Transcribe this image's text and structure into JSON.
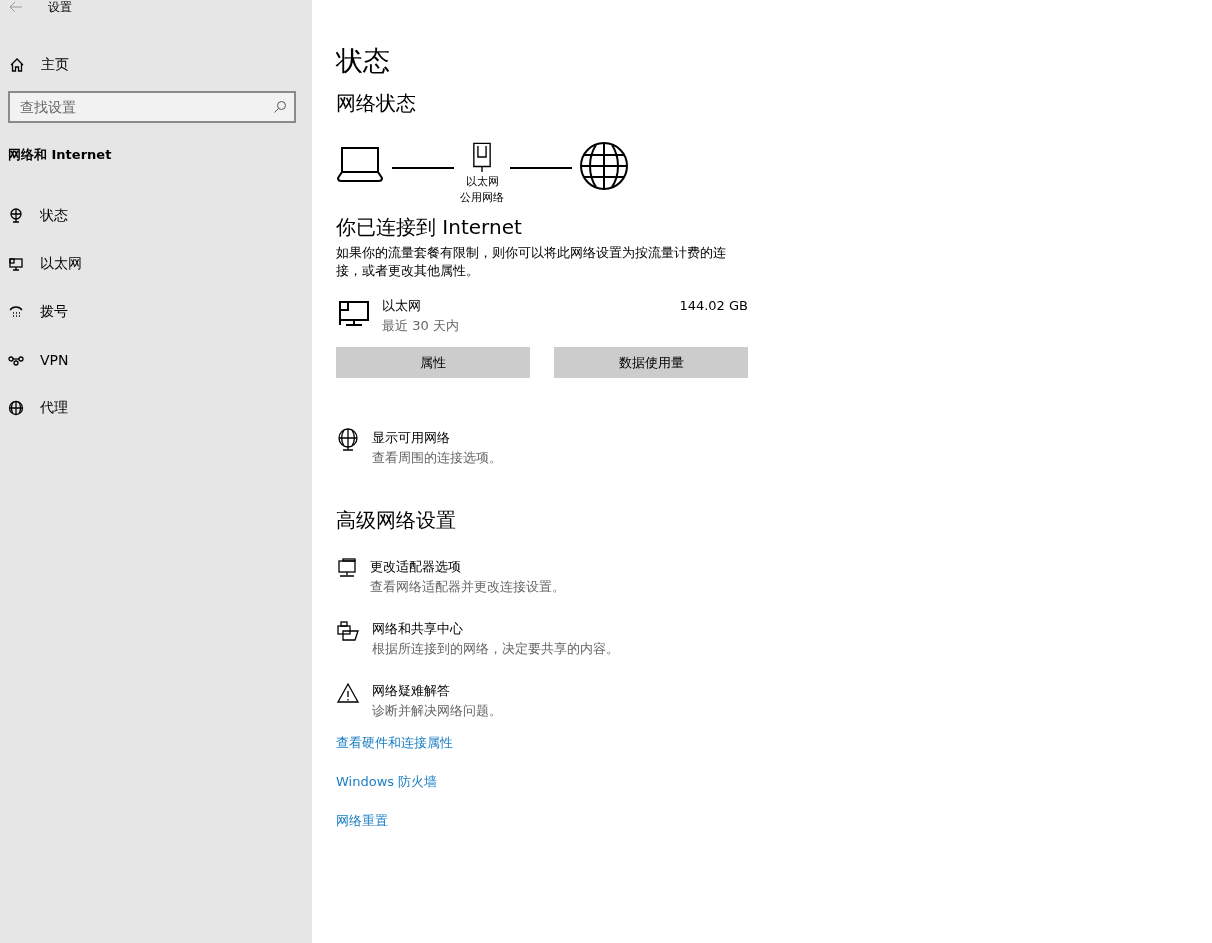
{
  "window": {
    "title": "设置"
  },
  "sidebar": {
    "home": "主页",
    "search": {
      "placeholder": "查找设置"
    },
    "section_title": "网络和 Internet",
    "items": [
      {
        "label": "状态"
      },
      {
        "label": "以太网"
      },
      {
        "label": "拨号"
      },
      {
        "label": "VPN"
      },
      {
        "label": "代理"
      }
    ]
  },
  "main": {
    "title": "状态",
    "network_status": {
      "heading": "网络状态",
      "adapter_name": "以太网",
      "network_type": "公用网络"
    },
    "connection": {
      "heading": "你已连接到 Internet",
      "description": "如果你的流量套餐有限制，则你可以将此网络设置为按流量计费的连接，或者更改其他属性。"
    },
    "usage": {
      "name": "以太网",
      "period": "最近 30 天内",
      "amount": "144.02 GB"
    },
    "buttons": [
      "属性",
      "数据使用量"
    ],
    "show_networks": {
      "title": "显示可用网络",
      "subtitle": "查看周围的连接选项。"
    },
    "advanced": {
      "heading": "高级网络设置",
      "items": [
        {
          "title": "更改适配器选项",
          "subtitle": "查看网络适配器并更改连接设置。"
        },
        {
          "title": "网络和共享中心",
          "subtitle": "根据所连接到的网络，决定要共享的内容。"
        },
        {
          "title": "网络疑难解答",
          "subtitle": "诊断并解决网络问题。"
        }
      ]
    },
    "links": [
      "查看硬件和连接属性",
      "Windows 防火墙",
      "网络重置"
    ]
  }
}
